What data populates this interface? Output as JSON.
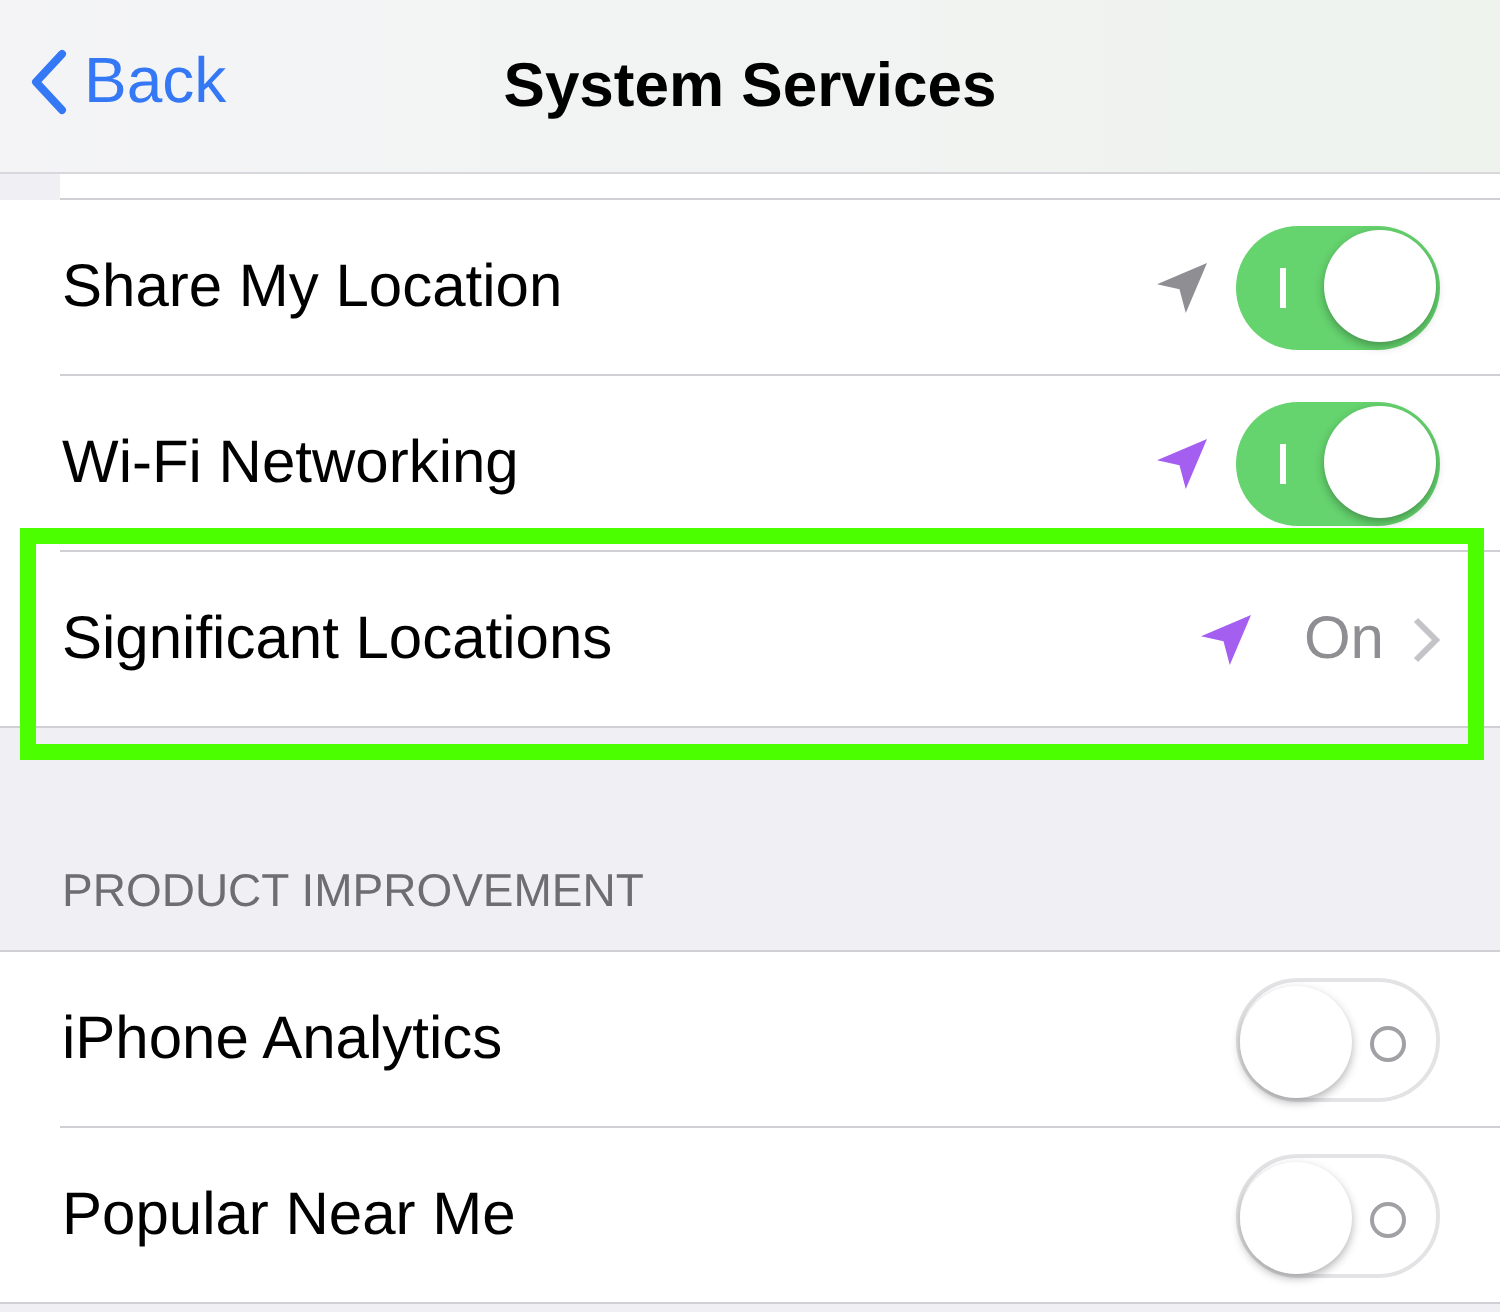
{
  "nav": {
    "back": "Back",
    "title": "System Services"
  },
  "groups": [
    {
      "rows": [
        {
          "label": "Share My Location",
          "kind": "toggle",
          "on": true,
          "color": "#8e8e93"
        },
        {
          "label": "Wi-Fi Networking",
          "kind": "toggle",
          "on": true,
          "color": "#a55ff0"
        },
        {
          "label": "Significant Locations",
          "kind": "detail",
          "value": "On",
          "color": "#a55ff0",
          "highlighted": true
        }
      ]
    },
    {
      "header": "PRODUCT IMPROVEMENT",
      "rows": [
        {
          "label": "iPhone Analytics",
          "kind": "toggle",
          "on": false
        },
        {
          "label": "Popular Near Me",
          "kind": "toggle",
          "on": false
        }
      ]
    }
  ]
}
